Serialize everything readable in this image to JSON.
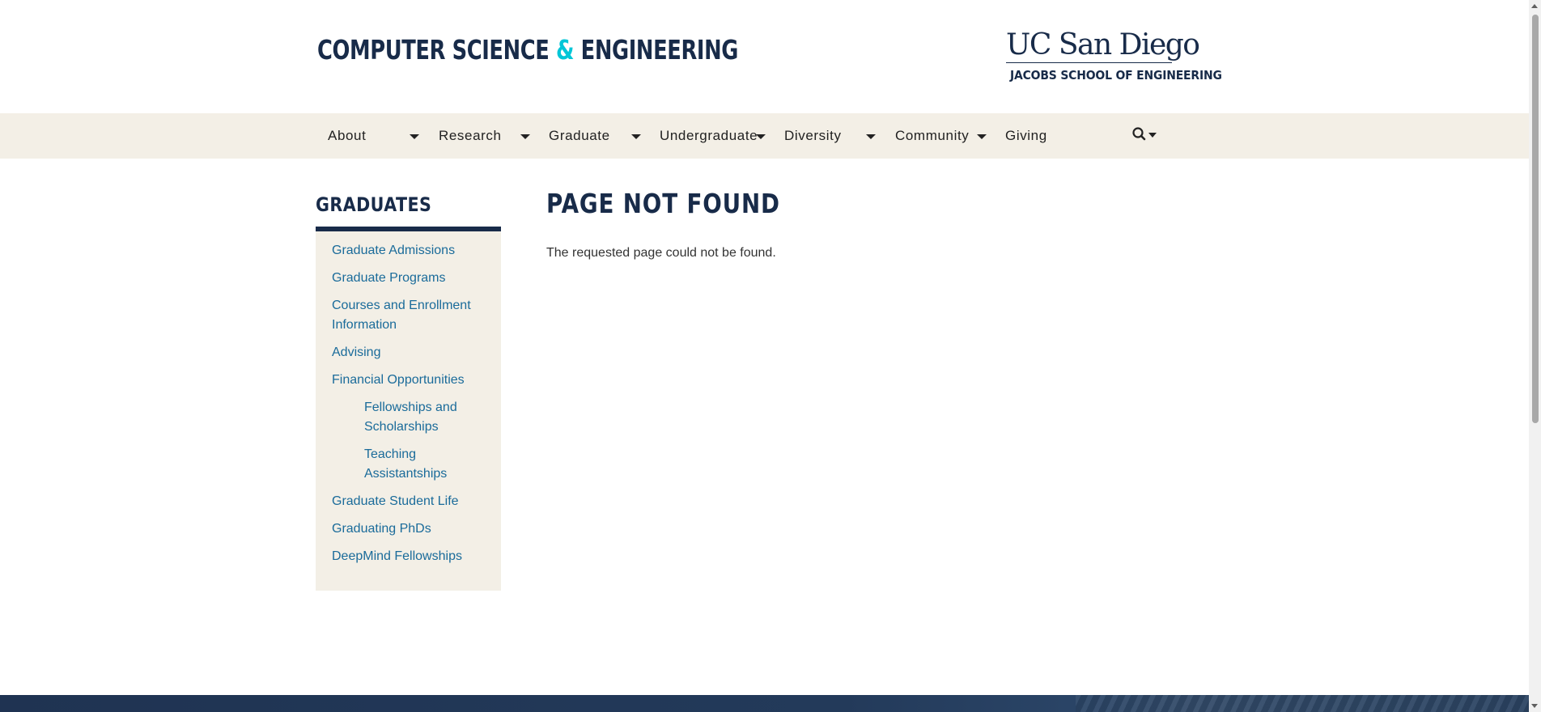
{
  "header": {
    "brand_main": "COMPUTER SCIENCE ",
    "brand_amp": "&",
    "brand_tail": " ENGINEERING",
    "ucsd_text": "UC San Diego",
    "jacobs_text": "JACOBS SCHOOL OF ENGINEERING"
  },
  "nav": {
    "items": [
      {
        "label": "About",
        "has_dropdown": true
      },
      {
        "label": "Research",
        "has_dropdown": true
      },
      {
        "label": "Graduate",
        "has_dropdown": true
      },
      {
        "label": "Undergraduate",
        "has_dropdown": true
      },
      {
        "label": "Diversity",
        "has_dropdown": true
      },
      {
        "label": "Community",
        "has_dropdown": true
      },
      {
        "label": "Giving",
        "has_dropdown": false
      }
    ],
    "search_icon": "search-icon"
  },
  "sidebar": {
    "title": "GRADUATES",
    "links": [
      {
        "label": "Graduate Admissions",
        "level": 1
      },
      {
        "label": "Graduate Programs",
        "level": 1
      },
      {
        "label": "Courses and Enrollment Information",
        "level": 1
      },
      {
        "label": "Advising",
        "level": 1
      },
      {
        "label": "Financial Opportunities",
        "level": 1
      },
      {
        "label": "Fellowships and Scholarships",
        "level": 2
      },
      {
        "label": "Teaching Assistantships",
        "level": 2
      },
      {
        "label": "Graduate Student Life",
        "level": 1
      },
      {
        "label": "Graduating PhDs",
        "level": 1
      },
      {
        "label": "DeepMind Fellowships",
        "level": 1
      }
    ]
  },
  "main": {
    "title": "PAGE NOT FOUND",
    "message": "The requested page could not be found."
  },
  "colors": {
    "navy": "#182b49",
    "accent": "#00c6d7",
    "sand": "#f3efe6",
    "link": "#1a6b9a"
  }
}
